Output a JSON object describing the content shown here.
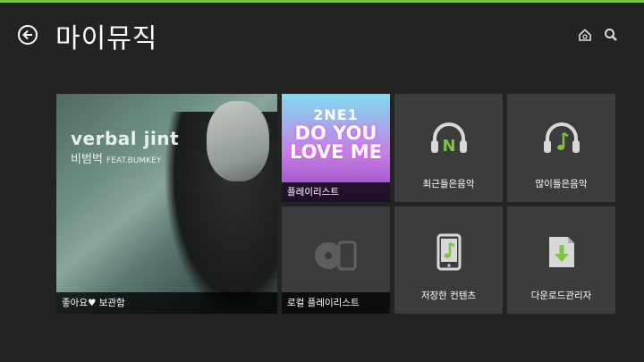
{
  "header": {
    "title": "마이뮤직",
    "back_icon": "back-arrow-icon",
    "home_icon": "home-icon",
    "search_icon": "search-icon",
    "accent": "#7dc242"
  },
  "tiles": {
    "liked": {
      "label": "좋아요♥ 보관함",
      "art_title": "verbal jint",
      "art_subtitle": "비범벅",
      "art_feat": "FEAT.BUMKEY"
    },
    "playlist": {
      "label": "플레이리스트",
      "art_line1": "2NE1",
      "art_line2": "DO YOU LOVE ME"
    },
    "recent": {
      "label": "최근들은음악",
      "icon": "headphones-n-icon"
    },
    "most_played": {
      "label": "많이들은음악",
      "icon": "headphones-note-icon"
    },
    "local_playlist": {
      "label": "로컬 플레이리스트",
      "icon": "cd-phone-icon"
    },
    "saved": {
      "label": "저장한 컨텐츠",
      "icon": "phone-note-icon"
    },
    "downloads": {
      "label": "다운로드관리자",
      "icon": "download-icon"
    }
  },
  "colors": {
    "icon_green": "#7dc242"
  }
}
